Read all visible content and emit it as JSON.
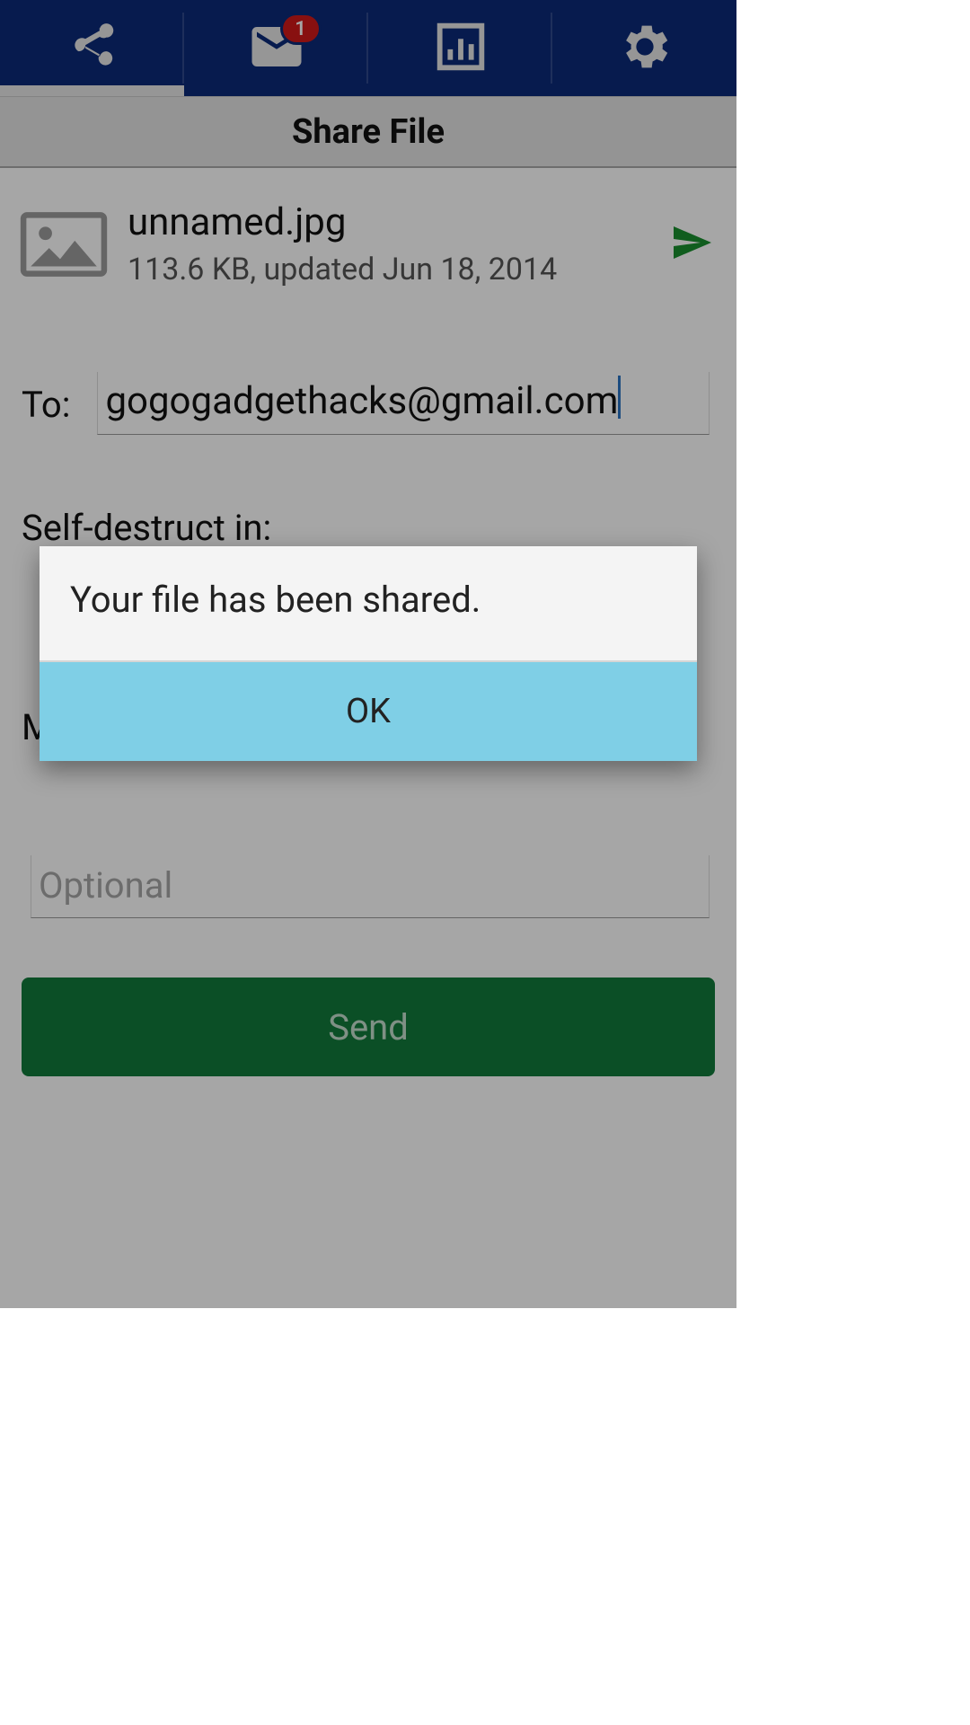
{
  "nav": {
    "inbox_badge": "1"
  },
  "page": {
    "title": "Share File"
  },
  "file": {
    "name": "unnamed.jpg",
    "detail": "113.6 KB, updated Jun 18, 2014"
  },
  "form": {
    "to_label": "To:",
    "to_value": "gogogadgethacks@gmail.com",
    "self_destruct_label": "Self-destruct in:",
    "message_label_partial": "M",
    "message_placeholder": "Optional",
    "send_label": "Send"
  },
  "dialog": {
    "message": "Your file has been shared.",
    "ok_label": "OK"
  }
}
